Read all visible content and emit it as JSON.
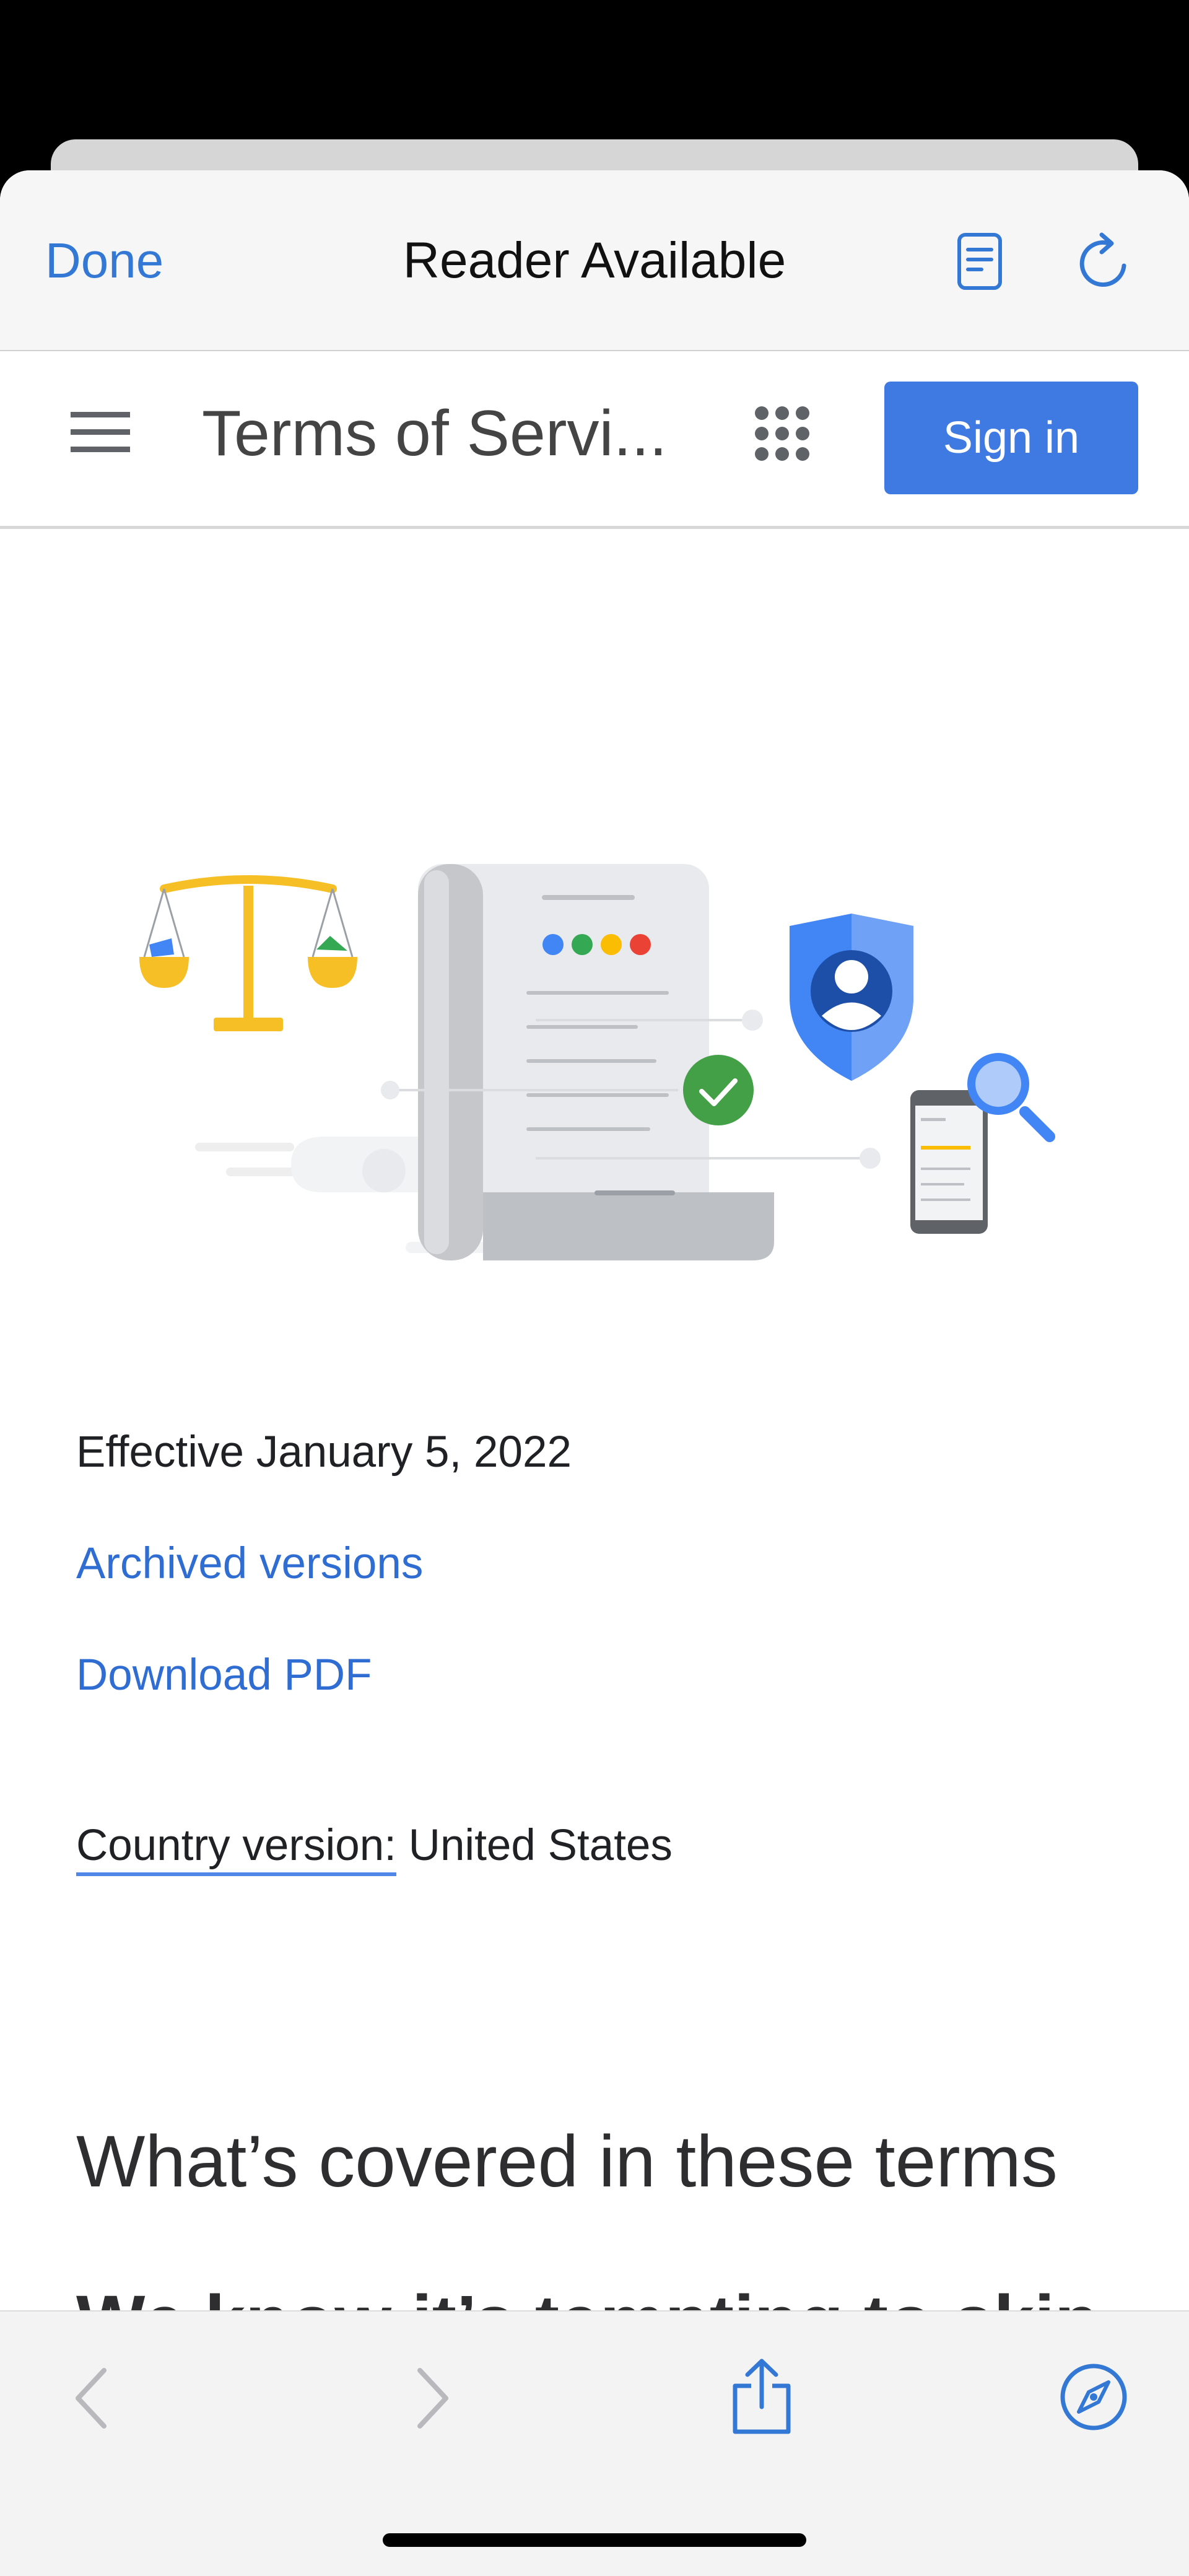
{
  "sheet_controls": {
    "done_label": "Done",
    "title": "Reader Available",
    "reader_icon": "reader-mode-icon",
    "reload_icon": "reload-icon"
  },
  "site_header": {
    "menu_icon": "hamburger-menu-icon",
    "title": "Terms of Servi...",
    "apps_icon": "google-apps-grid-icon",
    "signin_label": "Sign in"
  },
  "hero": {
    "illustration": "terms-of-service-illustration",
    "dot_colors": [
      "#4285f4",
      "#34a853",
      "#fbbc04",
      "#ea4335"
    ]
  },
  "content": {
    "effective": "Effective January 5, 2022",
    "archived_link": "Archived versions",
    "pdf_link": "Download PDF",
    "country_label": "Country version:",
    "country_value": " United States",
    "heading_covered": "What’s covered in these terms",
    "heading_tempting": "We know it’s tempting to skip these Terms of Service, but"
  },
  "toolbar": {
    "back_icon": "back-chevron-icon",
    "forward_icon": "forward-chevron-icon",
    "share_icon": "share-icon",
    "safari_icon": "compass-safari-icon"
  },
  "colors": {
    "accent": "#3478d6",
    "signin_bg": "#3f7ae3",
    "link": "#2f6dd3"
  }
}
